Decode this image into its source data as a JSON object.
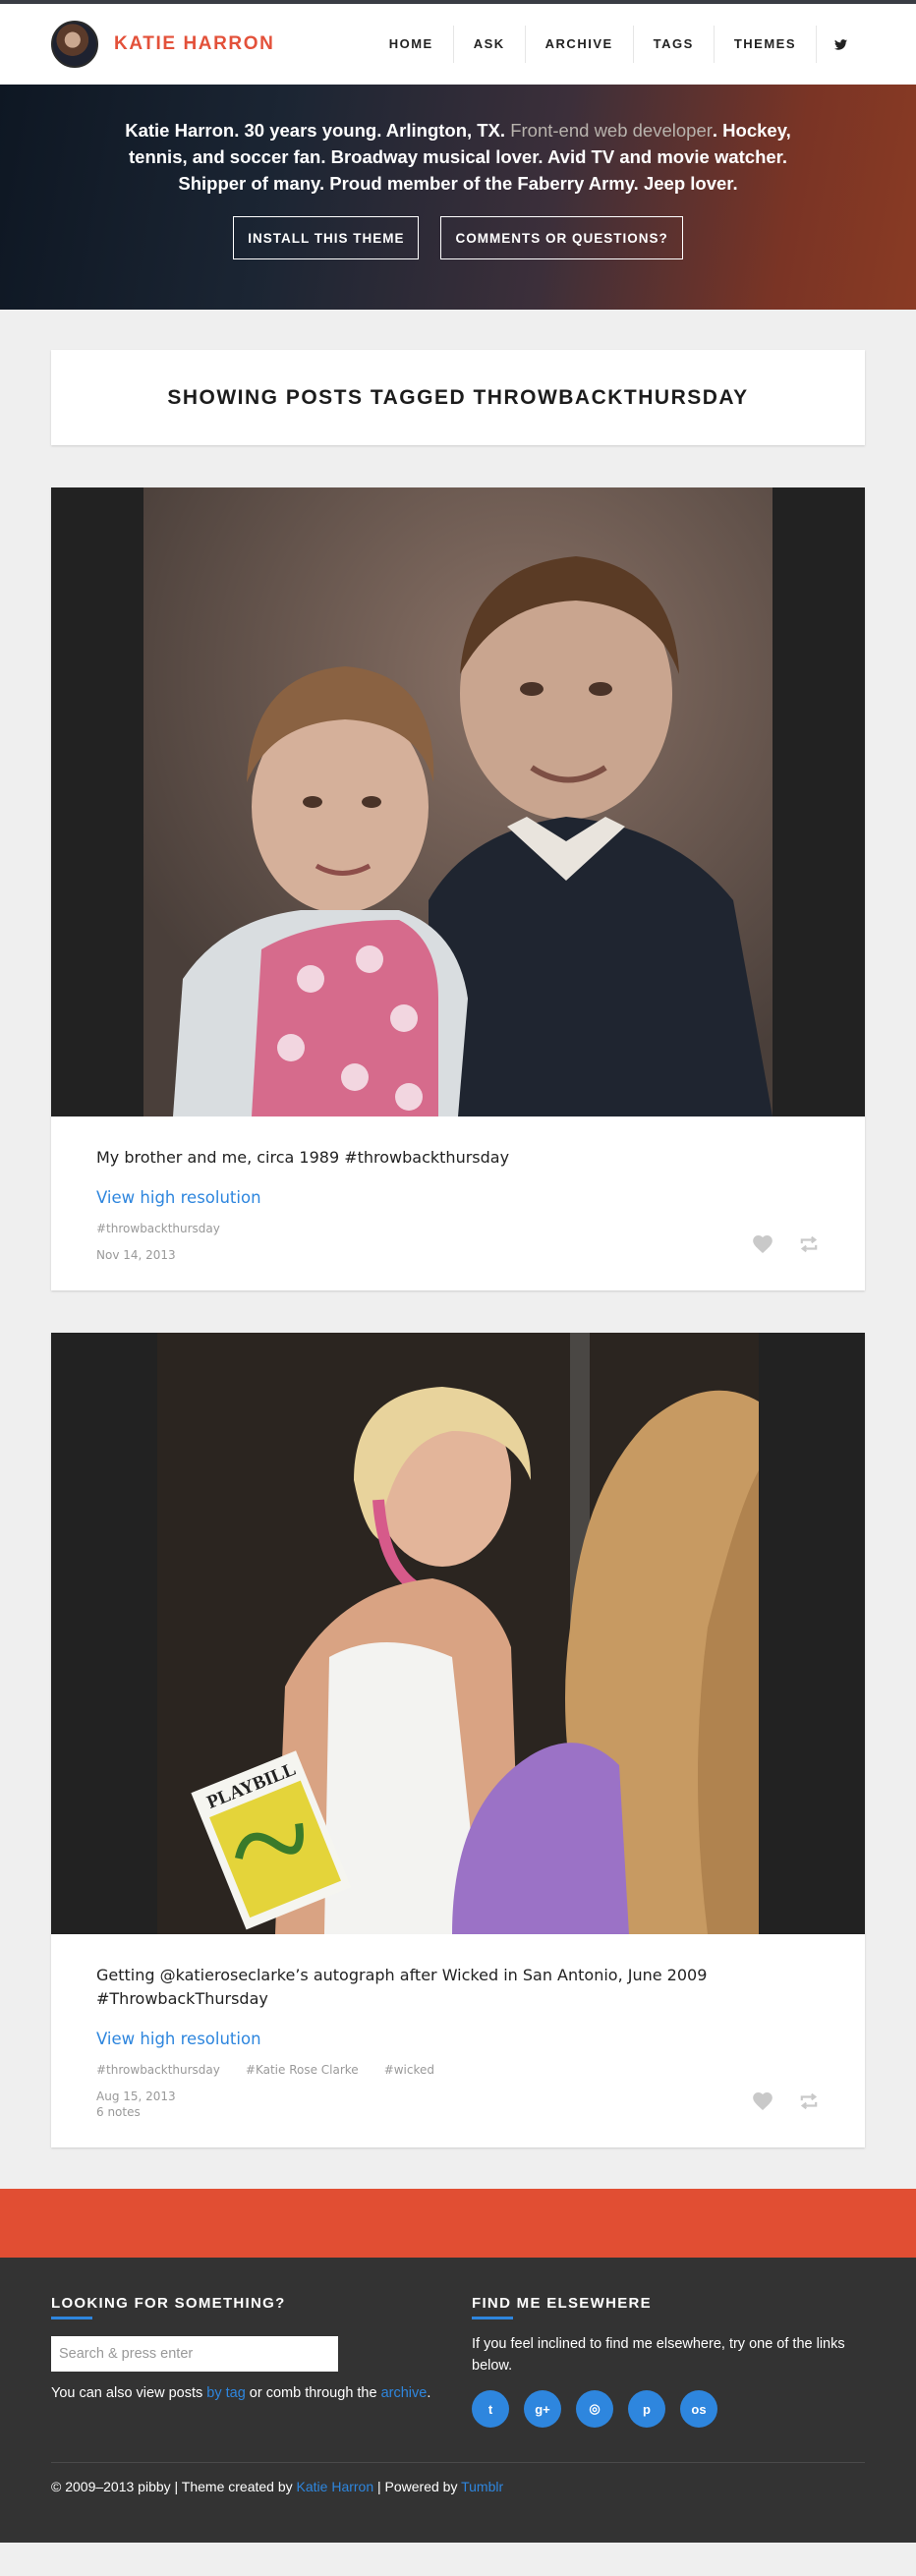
{
  "site": {
    "title": "KATIE HARRON"
  },
  "nav": {
    "items": [
      "HOME",
      "ASK",
      "ARCHIVE",
      "TAGS",
      "THEMES"
    ],
    "twitter_icon": "twitter-icon"
  },
  "hero": {
    "bio_part1": "Katie Harron. 30 years young. Arlington, TX. ",
    "bio_link": "Front-end web developer",
    "bio_part2": ". Hockey, tennis, and soccer fan. Broadway musical lover. Avid TV and movie watcher. Shipper of many. Proud member of the Faberry Army. Jeep lover.",
    "install_button": "INSTALL THIS THEME",
    "comments_button": "COMMENTS OR QUESTIONS?"
  },
  "tag_header": "SHOWING POSTS TAGGED THROWBACKTHURSDAY",
  "posts": [
    {
      "caption": "My brother and me, circa 1989 #throwbackthursday",
      "hires_link": "View high resolution",
      "tags": [
        "#throwbackthursday"
      ],
      "date": "Nov 14, 2013",
      "notes": ""
    },
    {
      "caption": "Getting @katieroseclarke’s autograph after Wicked in San Antonio, June 2009 #ThrowbackThursday",
      "hires_link": "View high resolution",
      "tags": [
        "#throwbackthursday",
        "#Katie Rose Clarke",
        "#wicked"
      ],
      "date": "Aug 15, 2013",
      "notes": "6 notes",
      "playbill_text": "PLAYBILL"
    }
  ],
  "footer": {
    "search_heading": "LOOKING FOR SOMETHING?",
    "search_placeholder": "Search & press enter",
    "search_text1": "You can also view posts ",
    "search_link1": "by tag",
    "search_text2": " or comb through the ",
    "search_link2": "archive",
    "search_text3": ".",
    "elsewhere_heading": "FIND ME ELSEWHERE",
    "elsewhere_text": "If you feel inclined to find me elsewhere, try one of the links below.",
    "social_icons": [
      "twitter-icon",
      "google-plus-icon",
      "instagram-icon",
      "pinterest-icon",
      "lastfm-icon"
    ],
    "social_glyphs": [
      "t",
      "g+",
      "◎",
      "p",
      "os"
    ],
    "copyright1": "© 2009–2013 pibby | Theme created by ",
    "copyright_link1": "Katie Harron",
    "copyright2": " | Powered by ",
    "copyright_link2": "Tumblr"
  },
  "colors": {
    "accent": "#e3513a",
    "band": "#e14e33",
    "link": "#2e86de",
    "footer_bg": "#333333"
  }
}
